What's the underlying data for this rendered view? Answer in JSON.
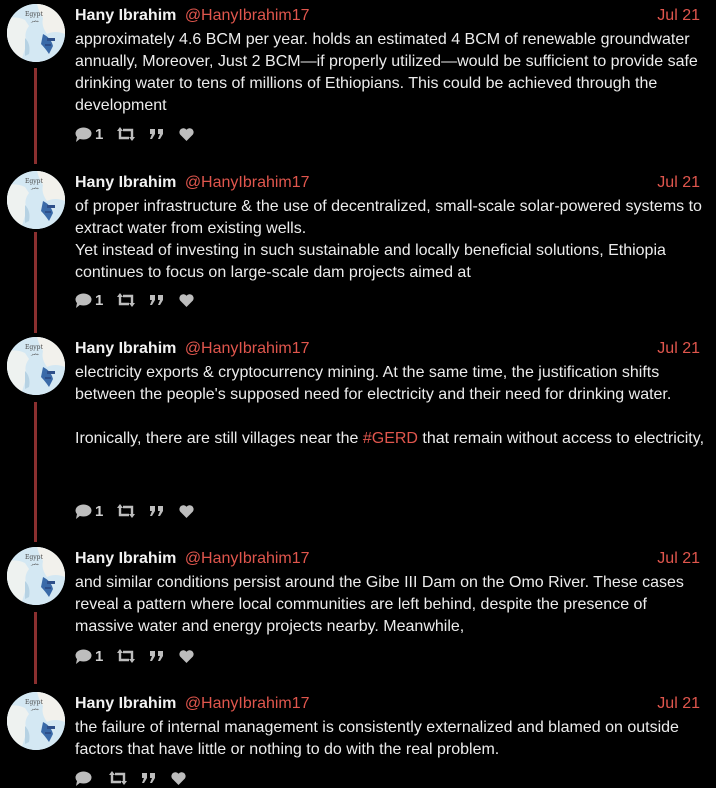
{
  "thread": {
    "accent_color": "#e0564d",
    "line_color": "#8a2f2f",
    "tweets": [
      {
        "name": "Hany Ibrahim",
        "handle": "@HanyIbrahim17",
        "date": "Jul 21",
        "avatar_text": "Egypt",
        "paragraphs": [
          "approximately 4.6 BCM per year. holds an estimated 4 BCM of renewable groundwater annually, Moreover,  Just 2 BCM—if properly utilized—would be sufficient to provide safe drinking water to tens of millions of Ethiopians. This could be achieved through the development"
        ],
        "reply_count": "1"
      },
      {
        "name": "Hany Ibrahim",
        "handle": "@HanyIbrahim17",
        "date": "Jul 21",
        "avatar_text": "Egypt",
        "paragraphs": [
          "of proper infrastructure & the use of decentralized, small-scale solar-powered systems to extract water from existing wells.",
          "Yet instead of investing in such sustainable and locally beneficial solutions, Ethiopia continues to focus on large-scale dam projects aimed at"
        ],
        "reply_count": "1"
      },
      {
        "name": "Hany Ibrahim",
        "handle": "@HanyIbrahim17",
        "date": "Jul 21",
        "avatar_text": "Egypt",
        "paragraphs": [
          "electricity exports & cryptocurrency mining. At the same time, the justification shifts between the people's supposed need for electricity and their need for drinking water."
        ],
        "p3_before": "Ironically, there are still villages near the ",
        "hashtag": "#GERD",
        "p3_after": " that remain without access to electricity,",
        "reply_count": "1"
      },
      {
        "name": "Hany Ibrahim",
        "handle": "@HanyIbrahim17",
        "date": "Jul 21",
        "avatar_text": "Egypt",
        "paragraphs": [
          "and similar conditions persist around the Gibe III Dam on the Omo River. These cases reveal a pattern where local communities are left behind, despite the presence of massive water and energy projects nearby. Meanwhile,"
        ],
        "reply_count": "1"
      },
      {
        "name": "Hany Ibrahim",
        "handle": "@HanyIbrahim17",
        "date": "Jul 21",
        "avatar_text": "Egypt",
        "paragraphs": [
          "the failure of internal management is consistently externalized and blamed on outside factors that have little or nothing to do with the real problem."
        ],
        "reply_count": ""
      }
    ]
  }
}
